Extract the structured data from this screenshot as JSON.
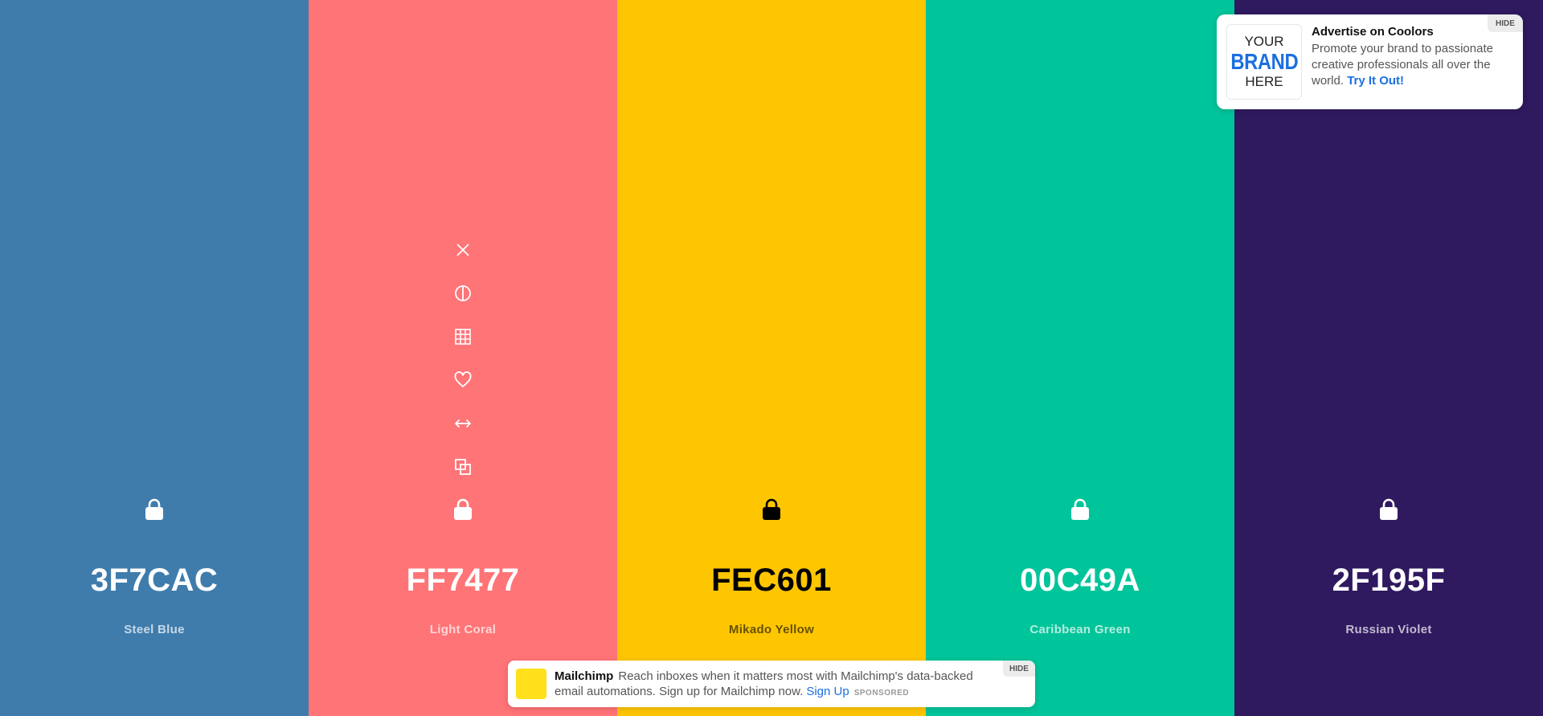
{
  "palette": [
    {
      "hex": "3F7CAC",
      "name": "Steel Blue",
      "bg": "#3F7CAC",
      "text_color": "#ffffff",
      "name_color": "rgba(255,255,255,0.7)",
      "lock_color": "#ffffff",
      "icon": "lock-icon"
    },
    {
      "hex": "FF7477",
      "name": "Light Coral",
      "bg": "#FF7477",
      "text_color": "#ffffff",
      "name_color": "rgba(255,255,255,0.7)",
      "lock_color": "#ffffff",
      "icon": "lock-icon"
    },
    {
      "hex": "FEC601",
      "name": "Mikado Yellow",
      "bg": "#FEC601",
      "text_color": "#000000",
      "name_color": "rgba(0,0,0,0.6)",
      "lock_color": "#000000",
      "icon": "lock-icon"
    },
    {
      "hex": "00C49A",
      "name": "Caribbean Green",
      "bg": "#00C49A",
      "text_color": "#ffffff",
      "name_color": "rgba(255,255,255,0.7)",
      "lock_color": "#ffffff",
      "icon": "lock-icon"
    },
    {
      "hex": "2F195F",
      "name": "Russian Violet",
      "bg": "#2F195F",
      "text_color": "#ffffff",
      "name_color": "rgba(255,255,255,0.7)",
      "lock_color": "#ffffff",
      "icon": "lock-icon"
    }
  ],
  "hover_tools": [
    "close-icon",
    "contrast-icon",
    "shades-grid-icon",
    "heart-icon",
    "drag-arrows-icon",
    "copy-icon"
  ],
  "ad_top": {
    "brand_line1": "YOUR",
    "brand_line2": "BRAND",
    "brand_line3": "HERE",
    "title": "Advertise on Coolors",
    "body": "Promote your brand to passionate creative professionals all over the world.",
    "link": "Try It Out!",
    "hide": "HIDE"
  },
  "ad_bottom": {
    "company": "Mailchimp",
    "text": "Reach inboxes when it matters most with Mailchimp's data-backed email automations. Sign up for Mailchimp now.",
    "link": "Sign Up",
    "sponsored": "SPONSORED",
    "hide": "HIDE",
    "logo_color": "#ffe01b"
  }
}
